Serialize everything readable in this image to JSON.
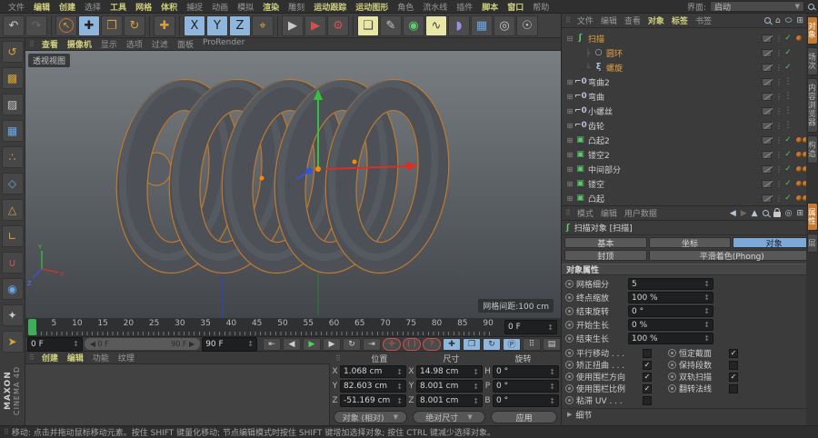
{
  "menubar": {
    "items": [
      {
        "label": "文件",
        "hl": false
      },
      {
        "label": "编辑",
        "hl": true
      },
      {
        "label": "创建",
        "hl": true
      },
      {
        "label": "选择",
        "hl": false
      },
      {
        "label": "工具",
        "hl": true
      },
      {
        "label": "网格",
        "hl": true
      },
      {
        "label": "体积",
        "hl": true
      },
      {
        "label": "捕捉",
        "hl": false
      },
      {
        "label": "动画",
        "hl": false
      },
      {
        "label": "模拟",
        "hl": false
      },
      {
        "label": "渲染",
        "hl": true
      },
      {
        "label": "雕刻",
        "hl": false
      },
      {
        "label": "运动跟踪",
        "hl": true
      },
      {
        "label": "运动图形",
        "hl": true
      },
      {
        "label": "角色",
        "hl": false
      },
      {
        "label": "流水线",
        "hl": false
      },
      {
        "label": "插件",
        "hl": false
      },
      {
        "label": "脚本",
        "hl": true
      },
      {
        "label": "窗口",
        "hl": true
      },
      {
        "label": "帮助",
        "hl": false
      }
    ],
    "interface_label": "界面:",
    "interface_value": "启动"
  },
  "toolbar": {
    "buttons": [
      {
        "name": "undo-button",
        "glyph": "↶",
        "cls": "g-gray"
      },
      {
        "name": "redo-button",
        "glyph": "↷",
        "cls": "dim"
      },
      {
        "name": "sep1",
        "sep": true
      },
      {
        "name": "live-selection-tool",
        "glyph": "↖",
        "cls": "ring"
      },
      {
        "name": "move-tool",
        "glyph": "✚",
        "cls": "blue"
      },
      {
        "name": "scale-tool",
        "glyph": "❒",
        "cls": "g-orange"
      },
      {
        "name": "rotate-tool",
        "glyph": "↻",
        "cls": "g-orange"
      },
      {
        "name": "sep2",
        "sep": true
      },
      {
        "name": "last-used-tool",
        "glyph": "✚",
        "cls": "g-orange"
      },
      {
        "name": "sep3",
        "sep": true
      },
      {
        "name": "lock-x-axis-button",
        "glyph": "X",
        "cls": "blue"
      },
      {
        "name": "lock-y-axis-button",
        "glyph": "Y",
        "cls": "blue"
      },
      {
        "name": "lock-z-axis-button",
        "glyph": "Z",
        "cls": "blue"
      },
      {
        "name": "coordinate-system-button",
        "glyph": "⌖",
        "cls": "g-orange"
      },
      {
        "name": "sep4",
        "sep": true
      },
      {
        "name": "render-view-button",
        "glyph": "▶",
        "cls": "g-gray"
      },
      {
        "name": "render-picture-viewer-button",
        "glyph": "▶",
        "cls": "g-red"
      },
      {
        "name": "render-settings-button",
        "glyph": "⚙",
        "cls": "g-red"
      },
      {
        "name": "sep5",
        "sep": true
      },
      {
        "name": "add-cube-primitive-button",
        "glyph": "❑",
        "cls": "yel g-blue"
      },
      {
        "name": "spline-pen-button",
        "glyph": "✎",
        "cls": "g-gray"
      },
      {
        "name": "subdivision-surface-button",
        "glyph": "◉",
        "cls": "g-green"
      },
      {
        "name": "generators-sweep-button",
        "glyph": "∿",
        "cls": "yel g-green"
      },
      {
        "name": "deformer-button",
        "glyph": "◗",
        "cls": "g-violet"
      },
      {
        "name": "floor-button",
        "glyph": "▦",
        "cls": "g-blue"
      },
      {
        "name": "camera-button",
        "glyph": "◎",
        "cls": "g-gray"
      },
      {
        "name": "light-button",
        "glyph": "☉",
        "cls": "g-gray"
      }
    ]
  },
  "left_toolbar": {
    "buttons": [
      {
        "name": "make-editable-button",
        "glyph": "↺",
        "cls": "g-orange"
      },
      {
        "name": "model-mode-button",
        "glyph": "▩",
        "cls": "g-orange"
      },
      {
        "name": "texture-mode-button",
        "glyph": "▨",
        "cls": "g-gray"
      },
      {
        "name": "workplane-mode-button",
        "glyph": "▦",
        "cls": "g-blue"
      },
      {
        "name": "points-mode-button",
        "glyph": "∴",
        "cls": "g-orange"
      },
      {
        "name": "edges-mode-button",
        "glyph": "◇",
        "cls": "g-blue"
      },
      {
        "name": "polygons-mode-button",
        "glyph": "△",
        "cls": "g-orange"
      },
      {
        "name": "axis-mode-button",
        "glyph": "∟",
        "cls": "g-orange"
      },
      {
        "name": "snapping-button",
        "glyph": "∪",
        "cls": "g-red"
      },
      {
        "name": "quantize-button",
        "glyph": "◉",
        "cls": "g-blue"
      },
      {
        "name": "workplane-lock-button",
        "glyph": "✦",
        "cls": "g-gray"
      },
      {
        "name": "viewport-solo-button",
        "glyph": "➤",
        "cls": "g-orange"
      }
    ]
  },
  "logo": {
    "line1": "MAXON",
    "line2": "CINEMA 4D"
  },
  "viewport": {
    "menu": [
      {
        "label": "查看",
        "hl": true
      },
      {
        "label": "摄像机",
        "hl": true
      },
      {
        "label": "显示",
        "hl": false
      },
      {
        "label": "选项",
        "hl": false
      },
      {
        "label": "过滤",
        "hl": false
      },
      {
        "label": "面板",
        "hl": false
      },
      {
        "label": "ProRender",
        "hl": false
      }
    ],
    "view_label": "透视视图",
    "grid_label": "网格间距:100 cm",
    "axis_labels": {
      "x": "X",
      "y": "Y",
      "z": "Z"
    }
  },
  "timeline": {
    "ticks": [
      "0",
      "5",
      "10",
      "15",
      "20",
      "25",
      "30",
      "35",
      "40",
      "45",
      "50",
      "55",
      "60",
      "65",
      "70",
      "75",
      "80",
      "85",
      "90"
    ],
    "ruler_frame": "0 F",
    "frame_field": "0 F",
    "range_start": "◀ 0 F",
    "range_end": "90 F ▶",
    "end_field": "90 F",
    "transport": [
      {
        "name": "goto-start-button",
        "glyph": "⇤",
        "cls": ""
      },
      {
        "name": "previous-frame-button",
        "glyph": "◀",
        "cls": ""
      },
      {
        "name": "play-forwards-button",
        "glyph": "▶",
        "cls": "green"
      },
      {
        "name": "next-frame-button",
        "glyph": "▶",
        "cls": ""
      },
      {
        "name": "loop-playback-button",
        "glyph": "↻",
        "cls": ""
      },
      {
        "name": "goto-end-button",
        "glyph": "⇥",
        "cls": ""
      },
      {
        "name": "record-keyframe-button",
        "glyph": "✛",
        "cls": "red"
      },
      {
        "name": "autokeying-button",
        "glyph": "( )",
        "cls": "red"
      },
      {
        "name": "keyframe-selection-button",
        "glyph": "?",
        "cls": "red"
      },
      {
        "name": "key-position-button",
        "glyph": "✚",
        "cls": "bluekey"
      },
      {
        "name": "key-scale-button",
        "glyph": "❒",
        "cls": "bluekey"
      },
      {
        "name": "key-rotation-button",
        "glyph": "↻",
        "cls": "bluekey"
      },
      {
        "name": "key-parameter-button",
        "glyph": "Ⓟ",
        "cls": "bluekey"
      },
      {
        "name": "key-pla-button",
        "glyph": "⠿",
        "cls": ""
      },
      {
        "name": "timeline-panel-button",
        "glyph": "▤",
        "cls": ""
      }
    ]
  },
  "bottom_left_menu": [
    {
      "label": "创建",
      "hl": true
    },
    {
      "label": "编辑",
      "hl": true
    },
    {
      "label": "功能",
      "hl": false
    },
    {
      "label": "纹理",
      "hl": false
    }
  ],
  "coordinates": {
    "columns": [
      {
        "header": "位置",
        "fields": [
          {
            "label": "X",
            "value": "1.068 cm"
          },
          {
            "label": "Y",
            "value": "82.603 cm"
          },
          {
            "label": "Z",
            "value": "-51.169 cm"
          }
        ]
      },
      {
        "header": "尺寸",
        "fields": [
          {
            "label": "X",
            "value": "14.98 cm"
          },
          {
            "label": "Y",
            "value": "8.001 cm"
          },
          {
            "label": "Z",
            "value": "8.001 cm"
          }
        ]
      },
      {
        "header": "旋转",
        "fields": [
          {
            "label": "H",
            "value": "0 °"
          },
          {
            "label": "P",
            "value": "0 °"
          },
          {
            "label": "B",
            "value": "0 °"
          }
        ]
      }
    ],
    "mode_dropdown": "对象 (相对)",
    "size_dropdown": "绝对尺寸",
    "apply_label": "应用"
  },
  "object_manager": {
    "menu": [
      {
        "label": "文件",
        "hl": false
      },
      {
        "label": "编辑",
        "hl": false
      },
      {
        "label": "查看",
        "hl": false
      },
      {
        "label": "对象",
        "hl": true
      },
      {
        "label": "标签",
        "hl": true
      },
      {
        "label": "书签",
        "hl": false
      }
    ],
    "tree": [
      {
        "name": "扫描",
        "depth": 0,
        "exp": "open",
        "icon": "sweep-object-icon",
        "sel": true,
        "state": "check",
        "materials": 1
      },
      {
        "name": "圆环",
        "depth": 1,
        "conn": "├",
        "icon": "circle-spline-icon",
        "sel": true,
        "state": "check",
        "materials": 0
      },
      {
        "name": "螺旋",
        "depth": 1,
        "conn": "└",
        "icon": "helix-spline-icon",
        "sel": true,
        "state": "check",
        "materials": 0
      },
      {
        "name": "弯曲2",
        "depth": 0,
        "exp": "closed",
        "icon": "bend-deformer-icon",
        "sel": false,
        "state": "off",
        "materials": 0
      },
      {
        "name": "弯曲",
        "depth": 0,
        "exp": "closed",
        "icon": "bend-deformer-icon",
        "sel": false,
        "state": "off",
        "materials": 0
      },
      {
        "name": "小螺丝",
        "depth": 0,
        "exp": "closed",
        "icon": "bend-deformer-icon",
        "sel": false,
        "state": "off",
        "materials": 0
      },
      {
        "name": "齿轮",
        "depth": 0,
        "exp": "closed",
        "icon": "bend-deformer-icon",
        "sel": false,
        "state": "off",
        "materials": 0
      },
      {
        "name": "凸起2",
        "depth": 0,
        "exp": "closed",
        "icon": "polygon-object-icon",
        "sel": false,
        "state": "check",
        "materials": 2
      },
      {
        "name": "镂空2",
        "depth": 0,
        "exp": "closed",
        "icon": "polygon-object-icon",
        "sel": false,
        "state": "check",
        "materials": 2
      },
      {
        "name": "中间部分",
        "depth": 0,
        "exp": "closed",
        "icon": "polygon-object-icon",
        "sel": false,
        "state": "check",
        "materials": 2
      },
      {
        "name": "镂空",
        "depth": 0,
        "exp": "closed",
        "icon": "polygon-object-icon",
        "sel": false,
        "state": "check",
        "materials": 2
      },
      {
        "name": "凸起",
        "depth": 0,
        "exp": "closed",
        "icon": "polygon-object-icon",
        "sel": false,
        "state": "check",
        "materials": 2
      }
    ],
    "icon_glyphs": {
      "sweep-object-icon": {
        "ch": "ʃ",
        "color": "#5ecb6e"
      },
      "circle-spline-icon": {
        "ch": "○",
        "color": "#aac6e2"
      },
      "helix-spline-icon": {
        "ch": "ξ",
        "color": "#aac6e2"
      },
      "bend-deformer-icon": {
        "ch": "⌐0",
        "color": "#bcbcd6"
      },
      "polygon-object-icon": {
        "ch": "▣",
        "color": "#5ecb6e"
      }
    }
  },
  "attributes": {
    "menu": [
      {
        "label": "模式",
        "hl": false
      },
      {
        "label": "编辑",
        "hl": false
      },
      {
        "label": "用户数据",
        "hl": false
      }
    ],
    "title": "扫描对象 [扫描]",
    "tabs_row1": [
      {
        "label": "基本",
        "active": false
      },
      {
        "label": "坐标",
        "active": false
      },
      {
        "label": "对象",
        "active": true
      }
    ],
    "tabs_row2": [
      {
        "label": "封顶",
        "active": false,
        "wide": false
      },
      {
        "label": "平滑着色(Phong)",
        "active": false,
        "wide": true
      }
    ],
    "section": "对象属性",
    "value_rows": [
      {
        "label": "网格细分",
        "value": "5"
      },
      {
        "label": "终点缩放",
        "value": "100 %"
      },
      {
        "label": "结束旋转",
        "value": "0 °"
      },
      {
        "label": "开始生长",
        "value": "0 %"
      },
      {
        "label": "结束生长",
        "value": "100 %"
      }
    ],
    "check_rows": [
      {
        "left": {
          "label": "平行移动 . . .",
          "checked": false
        },
        "right": {
          "label": "恒定截面",
          "checked": true
        }
      },
      {
        "left": {
          "label": "矫正扭曲 . . .",
          "checked": true
        },
        "right": {
          "label": "保持段数",
          "checked": false
        }
      },
      {
        "left": {
          "label": "使用围栏方向",
          "checked": true
        },
        "right": {
          "label": "双轨扫描",
          "checked": true
        }
      },
      {
        "left": {
          "label": "使用围栏比例",
          "checked": true
        },
        "right": {
          "label": "翻转法线",
          "checked": false
        }
      },
      {
        "left": {
          "label": "粘滞 UV . . .",
          "checked": false
        },
        "right": null
      }
    ],
    "details_label": "细节"
  },
  "side_tabs": {
    "top": [
      {
        "label": "对象",
        "active": true
      },
      {
        "label": "场次",
        "active": false
      },
      {
        "label": "内容浏览器",
        "active": false
      },
      {
        "label": "构造",
        "active": false
      }
    ],
    "bottom": [
      {
        "label": "属性",
        "active": true
      },
      {
        "label": "层",
        "active": false
      }
    ]
  },
  "status": {
    "text": "移动: 点击并拖动鼠标移动元素。按住 SHIFT 键量化移动; 节点编辑模式时按住 SHIFT 键增加选择对象; 按住 CTRL 键减少选择对象。"
  }
}
